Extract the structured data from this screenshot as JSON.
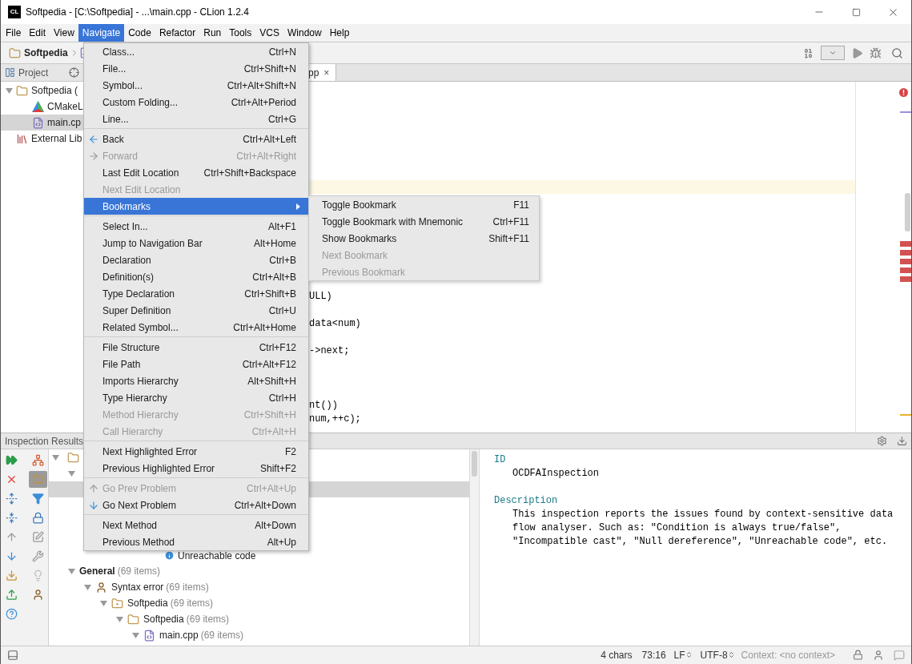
{
  "window": {
    "app_icon_text": "CL",
    "title": "Softpedia - [C:\\Softpedia] - ...\\main.cpp - CLion 1.2.4"
  },
  "menu_bar": [
    {
      "label": "File",
      "selected": false
    },
    {
      "label": "Edit",
      "selected": false
    },
    {
      "label": "View",
      "selected": false
    },
    {
      "label": "Navigate",
      "selected": true
    },
    {
      "label": "Code",
      "selected": false
    },
    {
      "label": "Refactor",
      "selected": false
    },
    {
      "label": "Run",
      "selected": false
    },
    {
      "label": "Tools",
      "selected": false
    },
    {
      "label": "VCS",
      "selected": false
    },
    {
      "label": "Window",
      "selected": false
    },
    {
      "label": "Help",
      "selected": false
    }
  ],
  "navigation_bar": {
    "crumb": "Softpedia"
  },
  "project_panel": {
    "title": "Project",
    "tree": [
      {
        "label": "Softpedia (",
        "kind": "folder",
        "expanded": true,
        "selected": false,
        "children": [
          {
            "label": "CMakeL",
            "kind": "cmake",
            "selected": false
          },
          {
            "label": "main.cp",
            "kind": "cpp",
            "selected": true
          }
        ]
      },
      {
        "label": "External Lib",
        "kind": "library",
        "selected": false
      }
    ]
  },
  "editor": {
    "tab": {
      "label": "pp",
      "close_glyph": "×"
    },
    "code_lines": [
      {
        "text": "ULL)"
      },
      {
        "text": "data<num)"
      },
      {
        "text": "->next;"
      },
      {
        "text": "nt())"
      },
      {
        "text": "num,++c);"
      }
    ]
  },
  "navigate_menu": {
    "sections": [
      [
        {
          "label": "Class...",
          "shortcut": "Ctrl+N",
          "kind": "plain",
          "disabled": false,
          "selected": false
        },
        {
          "label": "File...",
          "shortcut": "Ctrl+Shift+N",
          "kind": "plain",
          "disabled": false,
          "selected": false
        },
        {
          "label": "Symbol...",
          "shortcut": "Ctrl+Alt+Shift+N",
          "kind": "plain",
          "disabled": false,
          "selected": false
        },
        {
          "label": "Custom Folding...",
          "shortcut": "Ctrl+Alt+Period",
          "kind": "plain",
          "disabled": false,
          "selected": false
        },
        {
          "label": "Line...",
          "shortcut": "Ctrl+G",
          "kind": "plain",
          "disabled": false,
          "selected": false
        }
      ],
      [
        {
          "label": "Back",
          "shortcut": "Ctrl+Alt+Left",
          "kind": "back",
          "disabled": false,
          "selected": false
        },
        {
          "label": "Forward",
          "shortcut": "Ctrl+Alt+Right",
          "kind": "forward",
          "disabled": true,
          "selected": false
        },
        {
          "label": "Last Edit Location",
          "shortcut": "Ctrl+Shift+Backspace",
          "kind": "plain",
          "disabled": false,
          "selected": false
        },
        {
          "label": "Next Edit Location",
          "kind": "plain",
          "disabled": true,
          "selected": false
        },
        {
          "label": "Bookmarks",
          "kind": "submenu",
          "disabled": false,
          "selected": true
        }
      ],
      [
        {
          "label": "Select In...",
          "shortcut": "Alt+F1",
          "kind": "plain",
          "disabled": false,
          "selected": false
        },
        {
          "label": "Jump to Navigation Bar",
          "shortcut": "Alt+Home",
          "kind": "plain",
          "disabled": false,
          "selected": false
        },
        {
          "label": "Declaration",
          "shortcut": "Ctrl+B",
          "kind": "plain",
          "disabled": false,
          "selected": false
        },
        {
          "label": "Definition(s)",
          "shortcut": "Ctrl+Alt+B",
          "kind": "plain",
          "disabled": false,
          "selected": false
        },
        {
          "label": "Type Declaration",
          "shortcut": "Ctrl+Shift+B",
          "kind": "plain",
          "disabled": false,
          "selected": false
        },
        {
          "label": "Super Definition",
          "shortcut": "Ctrl+U",
          "kind": "plain",
          "disabled": false,
          "selected": false
        },
        {
          "label": "Related Symbol...",
          "shortcut": "Ctrl+Alt+Home",
          "kind": "plain",
          "disabled": false,
          "selected": false
        }
      ],
      [
        {
          "label": "File Structure",
          "shortcut": "Ctrl+F12",
          "kind": "plain",
          "disabled": false,
          "selected": false
        },
        {
          "label": "File Path",
          "shortcut": "Ctrl+Alt+F12",
          "kind": "plain",
          "disabled": false,
          "selected": false
        },
        {
          "label": "Imports Hierarchy",
          "shortcut": "Alt+Shift+H",
          "kind": "plain",
          "disabled": false,
          "selected": false
        },
        {
          "label": "Type Hierarchy",
          "shortcut": "Ctrl+H",
          "kind": "plain",
          "disabled": false,
          "selected": false
        },
        {
          "label": "Method Hierarchy",
          "shortcut": "Ctrl+Shift+H",
          "kind": "plain",
          "disabled": true,
          "selected": false
        },
        {
          "label": "Call Hierarchy",
          "shortcut": "Ctrl+Alt+H",
          "kind": "plain",
          "disabled": true,
          "selected": false
        }
      ],
      [
        {
          "label": "Next Highlighted Error",
          "shortcut": "F2",
          "kind": "plain",
          "disabled": false,
          "selected": false
        },
        {
          "label": "Previous Highlighted Error",
          "shortcut": "Shift+F2",
          "kind": "plain",
          "disabled": false,
          "selected": false
        }
      ],
      [
        {
          "label": "Go Prev Problem",
          "shortcut": "Ctrl+Alt+Up",
          "kind": "up",
          "disabled": true,
          "selected": false
        },
        {
          "label": "Go Next Problem",
          "shortcut": "Ctrl+Alt+Down",
          "kind": "down",
          "disabled": false,
          "selected": false
        }
      ],
      [
        {
          "label": "Next Method",
          "shortcut": "Alt+Down",
          "kind": "plain",
          "disabled": false,
          "selected": false
        },
        {
          "label": "Previous Method",
          "shortcut": "Alt+Up",
          "kind": "plain",
          "disabled": false,
          "selected": false
        }
      ]
    ]
  },
  "bookmarks_submenu": [
    {
      "label": "Toggle Bookmark",
      "shortcut": "F11",
      "disabled": false
    },
    {
      "label": "Toggle Bookmark with Mnemonic",
      "shortcut": "Ctrl+F11",
      "disabled": false
    },
    {
      "label": "Show Bookmarks",
      "shortcut": "Shift+F11",
      "disabled": false
    },
    {
      "label": "Next Bookmark",
      "disabled": true
    },
    {
      "label": "Previous Bookmark",
      "disabled": true
    }
  ],
  "inspection_panel": {
    "title": "Inspection Results",
    "partial_row": {
      "label": "Unreachable code"
    },
    "tree": [
      {
        "label": "General",
        "count": "(69 items)",
        "kind": "category",
        "expanded": true,
        "children": [
          {
            "label": "Syntax error",
            "count": "(69 items)",
            "kind": "inspection",
            "expanded": true,
            "children": [
              {
                "label": "Softpedia",
                "count": "(69 items)",
                "kind": "module",
                "expanded": true,
                "children": [
                  {
                    "label": "Softpedia",
                    "count": "(69 items)",
                    "kind": "folder",
                    "expanded": true,
                    "children": [
                      {
                        "label": "main.cpp",
                        "count": "(69 items)",
                        "kind": "file",
                        "expanded": true
                      }
                    ]
                  }
                ]
              }
            ]
          }
        ]
      }
    ],
    "details": {
      "id_heading": "ID",
      "id": "OCDFAInspection",
      "description_heading": "Description",
      "description": "This inspection reports the issues found by context-sensitive data flow analyser. Such as: \"Condition is always true/false\", \"Incompatible cast\", \"Null dereference\", \"Unreachable code\", etc."
    }
  },
  "status_bar": {
    "selection": "4 chars",
    "position": "73:16",
    "line_separator": "LF",
    "encoding": "UTF-8",
    "context": "Context: <no context>"
  }
}
